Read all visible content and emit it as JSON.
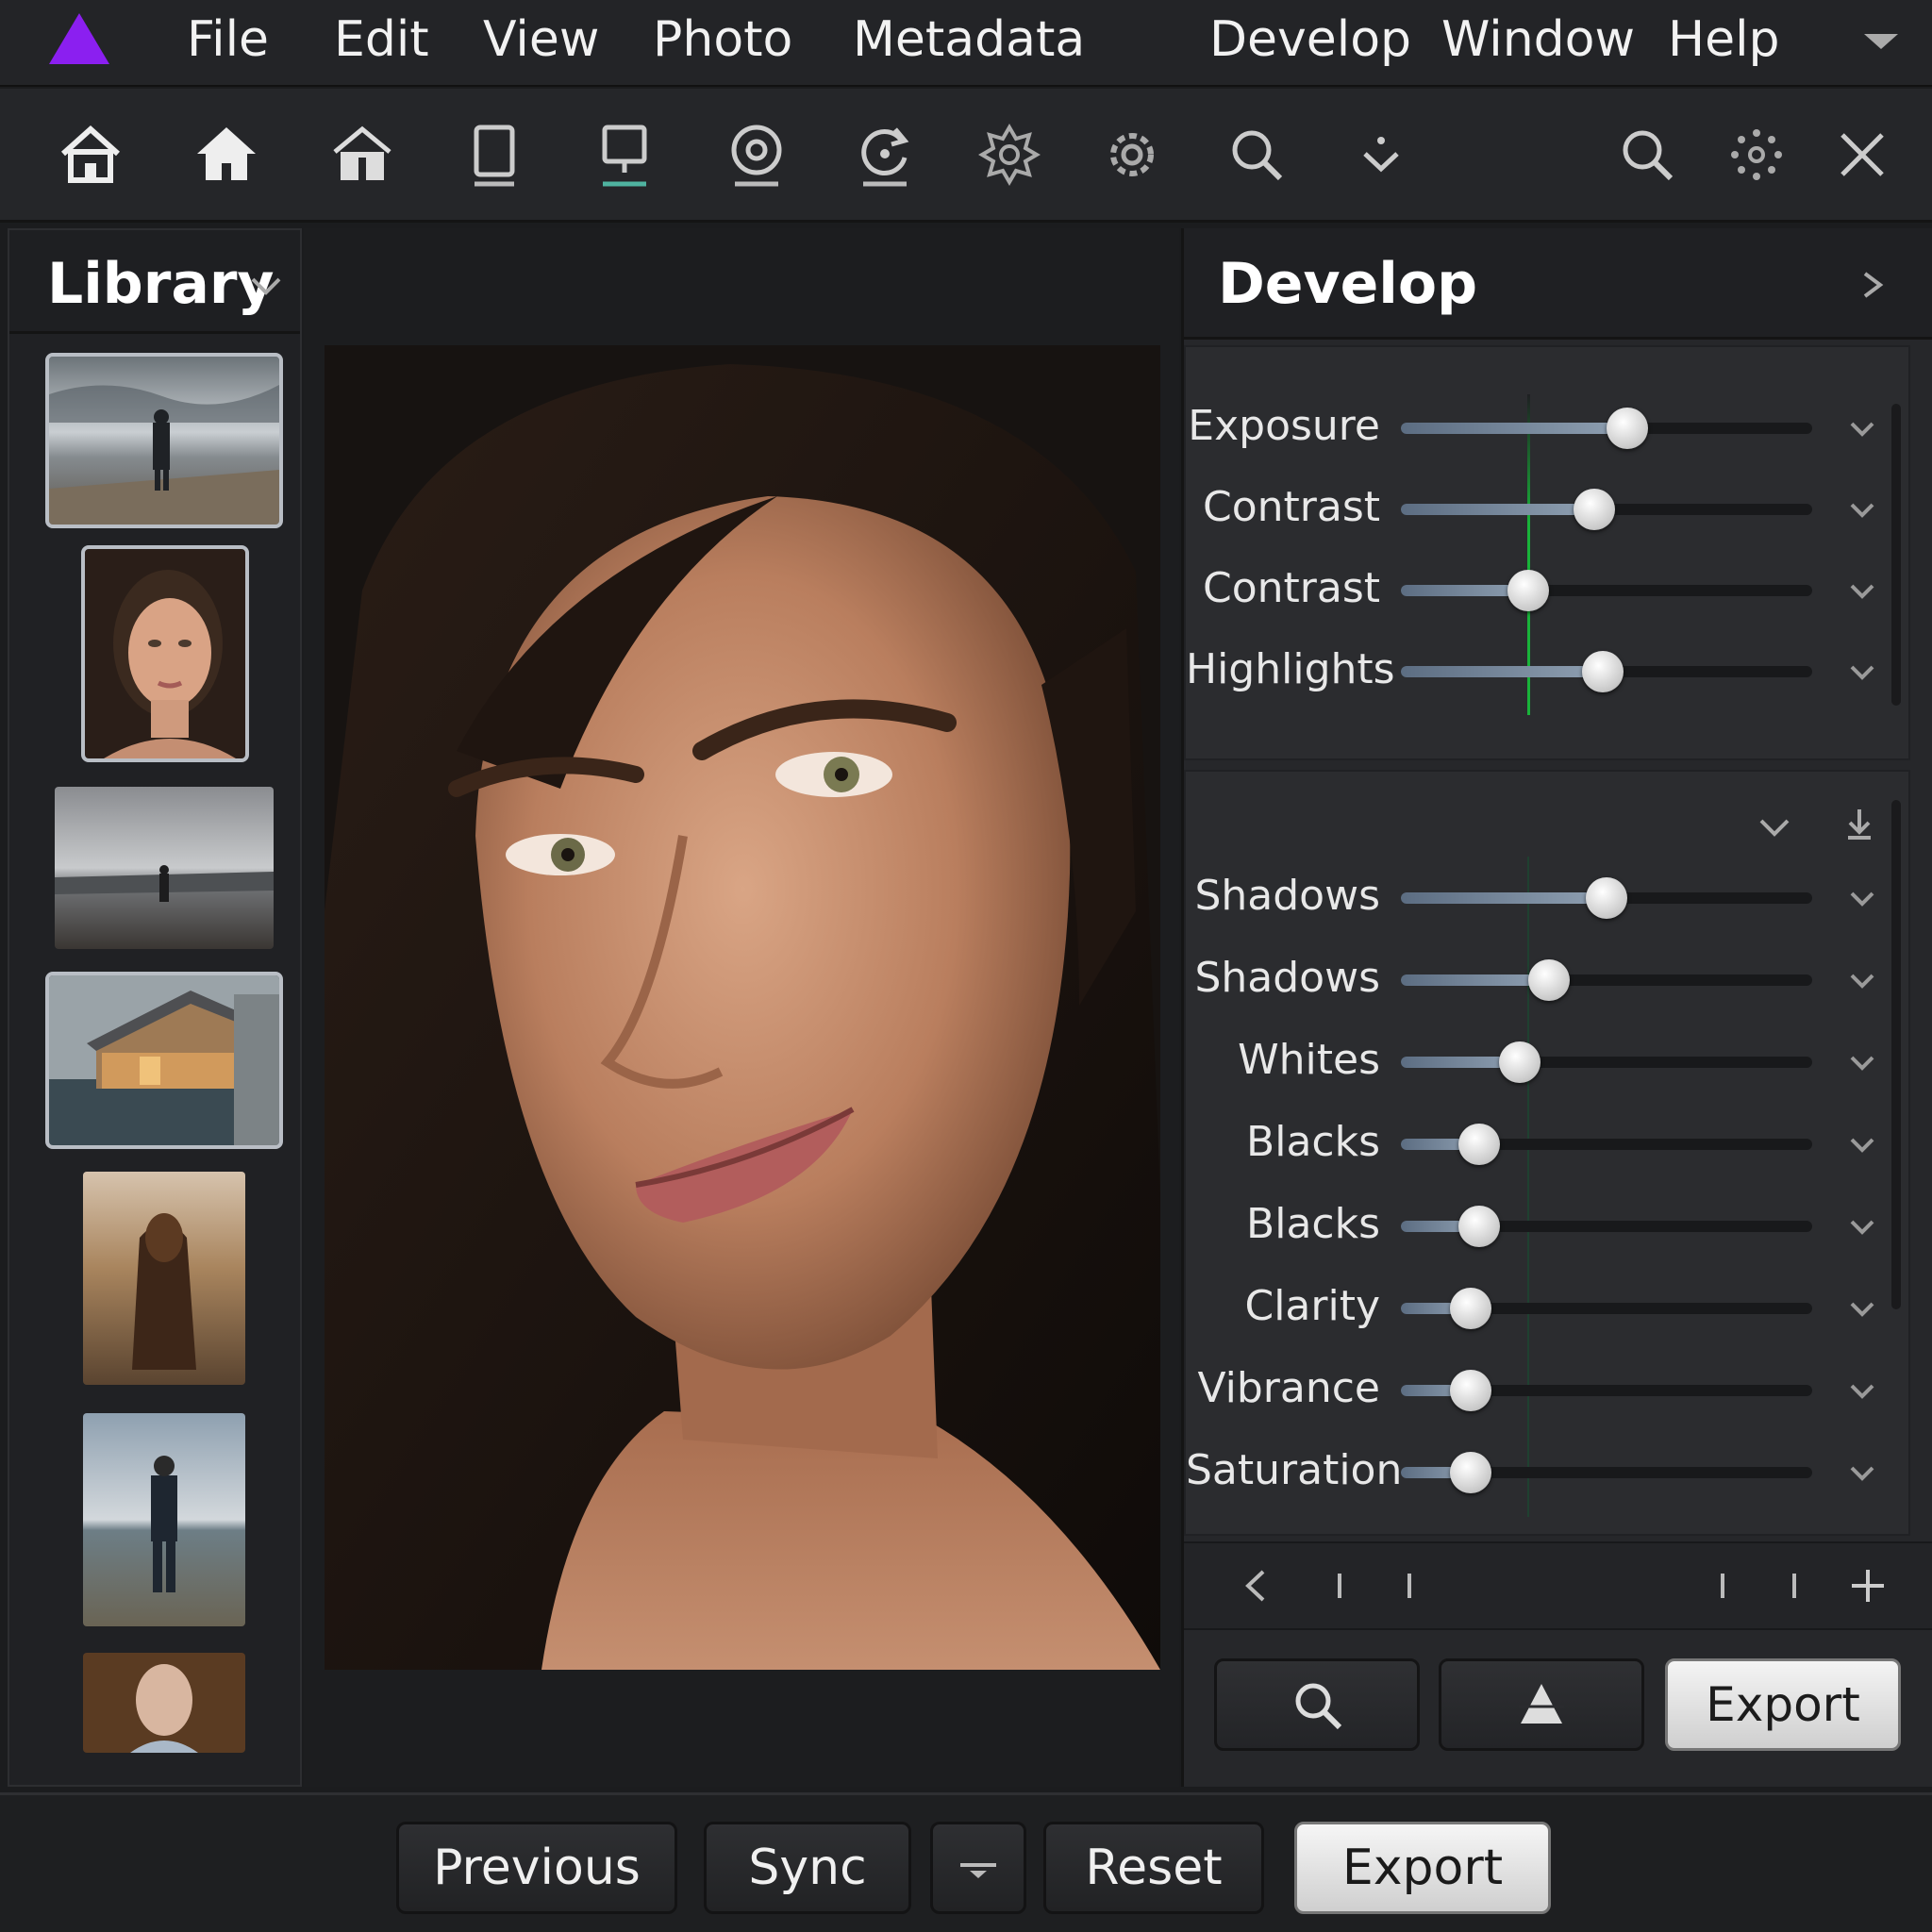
{
  "menu": {
    "items": [
      "File",
      "Edit",
      "View",
      "Photo",
      "Metadata",
      "Develop",
      "Window",
      "Help"
    ]
  },
  "toolbar": {
    "icons": [
      "home-icon",
      "home-filled-icon",
      "store-icon",
      "tablet-icon",
      "monitor-icon",
      "target-icon",
      "refresh-icon",
      "flower-gear-icon",
      "gear-icon",
      "search-icon",
      "download-arrow-icon",
      "search-icon",
      "loading-icon",
      "close-icon"
    ]
  },
  "library": {
    "title": "Library",
    "thumbnails": [
      "foggy-lake-figure",
      "portrait-woman",
      "overcast-shore-figure",
      "lakeside-cabin",
      "woman-at-shore",
      "hiker-by-lake",
      "portrait-partial"
    ]
  },
  "develop": {
    "title": "Develop",
    "group1": [
      {
        "label": "Exposure",
        "value": 0.55
      },
      {
        "label": "Contrast",
        "value": 0.47
      },
      {
        "label": "Contrast",
        "value": 0.31
      },
      {
        "label": "Highlights",
        "value": 0.49
      }
    ],
    "group2": [
      {
        "label": "Shadows",
        "value": 0.5
      },
      {
        "label": "Shadows",
        "value": 0.36
      },
      {
        "label": "Whites",
        "value": 0.29
      },
      {
        "label": "Blacks",
        "value": 0.19
      },
      {
        "label": "Blacks",
        "value": 0.19
      },
      {
        "label": "Clarity",
        "value": 0.17
      },
      {
        "label": "Vibrance",
        "value": 0.17
      },
      {
        "label": "Saturation",
        "value": 0.17
      }
    ],
    "buttons": {
      "export": "Export"
    }
  },
  "bottom": {
    "previous": "Previous",
    "sync": "Sync",
    "reset": "Reset",
    "export": "Export"
  },
  "colors": {
    "accent": "#8b1ff0",
    "guide_line": "#19b33a"
  }
}
